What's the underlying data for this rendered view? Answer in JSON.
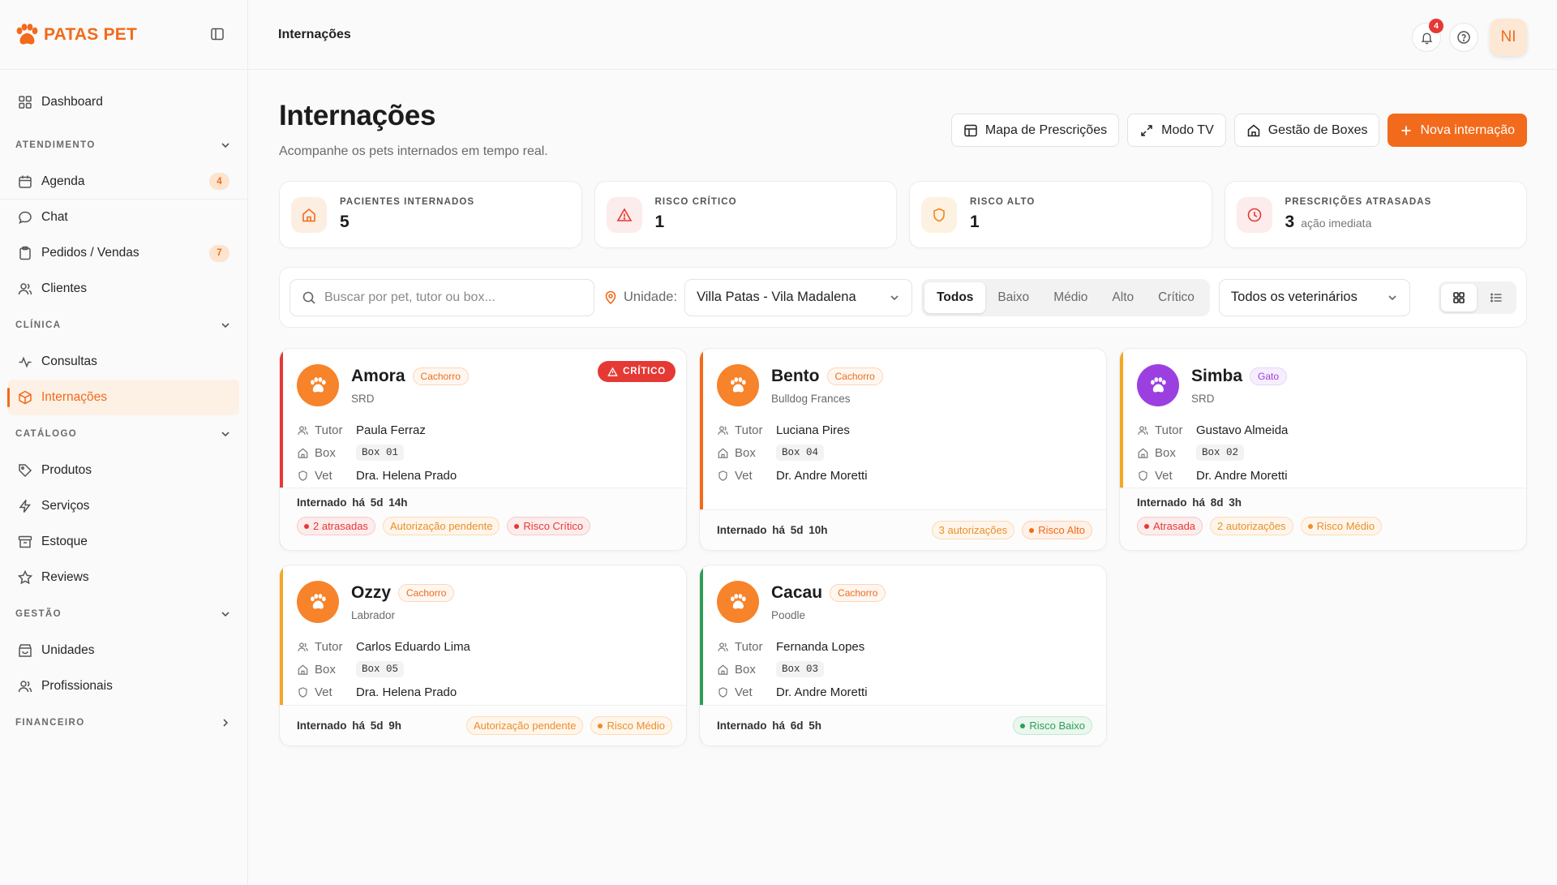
{
  "brand": {
    "name": "PATAS PET"
  },
  "sidebar": {
    "dashboard": "Dashboard",
    "sections": [
      {
        "title": "ATENDIMENTO",
        "items": [
          {
            "label": "Agenda",
            "badge": "4"
          },
          {
            "label": "Chat"
          },
          {
            "label": "Pedidos / Vendas",
            "badge": "7"
          },
          {
            "label": "Clientes"
          }
        ]
      },
      {
        "title": "CLÍNICA",
        "items": [
          {
            "label": "Consultas"
          },
          {
            "label": "Internações"
          }
        ]
      },
      {
        "title": "CATÁLOGO",
        "items": [
          {
            "label": "Produtos"
          },
          {
            "label": "Serviços"
          },
          {
            "label": "Estoque"
          },
          {
            "label": "Reviews"
          }
        ]
      },
      {
        "title": "GESTÃO",
        "items": [
          {
            "label": "Unidades"
          },
          {
            "label": "Profissionais"
          }
        ]
      },
      {
        "title": "FINANCEIRO",
        "items": []
      }
    ]
  },
  "topbar": {
    "breadcrumb": "Internações",
    "notifications": "4",
    "avatar_initials": "NI"
  },
  "page": {
    "title": "Internações",
    "subtitle": "Acompanhe os pets internados em tempo real.",
    "actions": {
      "map": "Mapa de Prescrições",
      "tv": "Modo TV",
      "boxes": "Gestão de Boxes",
      "new": "Nova internação"
    }
  },
  "stats": [
    {
      "label": "PACIENTES INTERNADOS",
      "value": "5",
      "note": ""
    },
    {
      "label": "RISCO CRÍTICO",
      "value": "1",
      "note": ""
    },
    {
      "label": "RISCO ALTO",
      "value": "1",
      "note": ""
    },
    {
      "label": "PRESCRIÇÕES ATRASADAS",
      "value": "3",
      "note": "ação imediata"
    }
  ],
  "filters": {
    "search_placeholder": "Buscar por pet, tutor ou box...",
    "unit_label": "Unidade:",
    "unit_value": "Villa Patas - Vila Madalena",
    "risk_tabs": [
      "Todos",
      "Baixo",
      "Médio",
      "Alto",
      "Crítico"
    ],
    "active_tab": "Todos",
    "vet_value": "Todos os veterinários"
  },
  "labels": {
    "tutor": "Tutor",
    "box": "Box",
    "vet": "Vet"
  },
  "patients": [
    {
      "name": "Amora",
      "species": "Cachorro",
      "breed": "SRD",
      "tutor": "Paula Ferraz",
      "box": "Box 01",
      "vet": "Dra. Helena Prado",
      "since": "Internado há 5d 14h",
      "critical_badge": "CRÍTICO",
      "pills": [
        "2 atrasadas",
        "Autorização pendente",
        "Risco Crítico"
      ]
    },
    {
      "name": "Bento",
      "species": "Cachorro",
      "breed": "Bulldog Frances",
      "tutor": "Luciana Pires",
      "box": "Box 04",
      "vet": "Dr. Andre Moretti",
      "since": "Internado há 5d 10h",
      "pills": [
        "3 autorizações",
        "Risco Alto"
      ]
    },
    {
      "name": "Simba",
      "species": "Gato",
      "breed": "SRD",
      "tutor": "Gustavo Almeida",
      "box": "Box 02",
      "vet": "Dr. Andre Moretti",
      "since": "Internado há 8d 3h",
      "pills": [
        "Atrasada",
        "2 autorizações",
        "Risco Médio"
      ]
    },
    {
      "name": "Ozzy",
      "species": "Cachorro",
      "breed": "Labrador",
      "tutor": "Carlos Eduardo Lima",
      "box": "Box 05",
      "vet": "Dra. Helena Prado",
      "since": "Internado há 5d 9h",
      "pills": [
        "Autorização pendente",
        "Risco Médio"
      ]
    },
    {
      "name": "Cacau",
      "species": "Cachorro",
      "breed": "Poodle",
      "tutor": "Fernanda Lopes",
      "box": "Box 03",
      "vet": "Dr. Andre Moretti",
      "since": "Internado há 6d 5h",
      "pills": [
        "Risco Baixo"
      ]
    }
  ],
  "colors": {
    "brand": "#f26a1b",
    "critical": "#e53935",
    "high": "#f26a1b",
    "medium": "#f5a623",
    "low": "#2e9e55",
    "cat": "#9c3fe0"
  }
}
